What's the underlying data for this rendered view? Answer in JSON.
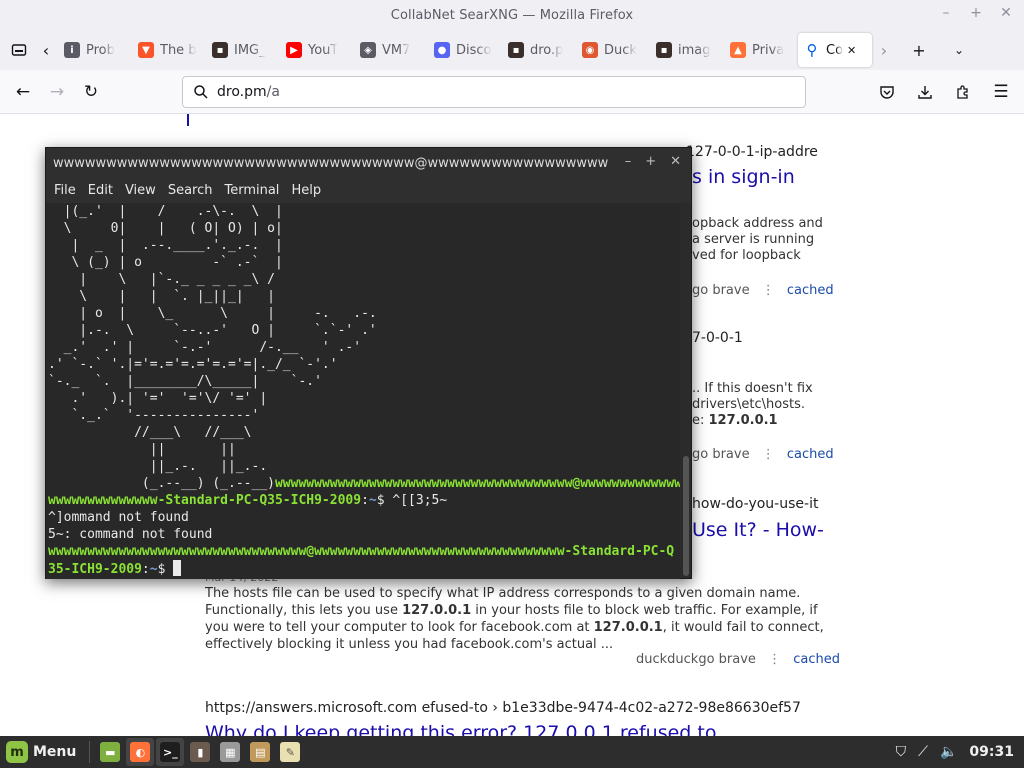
{
  "window": {
    "title": "CollabNet SearXNG — Mozilla Firefox",
    "controls": {
      "minimize": "–",
      "maximize": "+",
      "close": "✕"
    }
  },
  "tabs": [
    {
      "label": "Prob",
      "icon": "info-icon",
      "color": "#5b5b66",
      "glyph": "i"
    },
    {
      "label": "The b",
      "icon": "brave-icon",
      "color": "#fb542b",
      "glyph": "▼"
    },
    {
      "label": "IMG_",
      "icon": "image-file-icon",
      "color": "#3a2f2a",
      "glyph": "▪"
    },
    {
      "label": "YouT",
      "icon": "youtube-icon",
      "color": "#ff0000",
      "glyph": "▶"
    },
    {
      "label": "VM7",
      "icon": "vmware-icon",
      "color": "#5b5b66",
      "glyph": "◈"
    },
    {
      "label": "Disco",
      "icon": "discord-icon",
      "color": "#5865f2",
      "glyph": "●"
    },
    {
      "label": "dro.p",
      "icon": "image-file-icon",
      "color": "#3a2f2a",
      "glyph": "▪"
    },
    {
      "label": "Duck",
      "icon": "duckduckgo-icon",
      "color": "#de5833",
      "glyph": "◉"
    },
    {
      "label": "imag",
      "icon": "image-file-icon",
      "color": "#3a2f2a",
      "glyph": "▪"
    },
    {
      "label": "Priva",
      "icon": "privacy-icon",
      "color": "#ff7139",
      "glyph": "▲"
    },
    {
      "label": "Co",
      "icon": "search-icon",
      "color": "#0060df",
      "glyph": "⚲",
      "active": true
    }
  ],
  "url": {
    "host": "dro.pm",
    "path": "/a"
  },
  "results": [
    {
      "url_tail": "127-0-0-1-ip-addre",
      "title": "s in sign-in",
      "snippet": [
        "opback address and",
        "a server is running",
        "ved for loopback"
      ],
      "engines": "go  brave",
      "cached": "cached"
    },
    {
      "url_tail": "7-0-0-1",
      "snippet": [
        ".. If this doesn't fix",
        "drivers\\etc\\hosts.",
        "e: "
      ],
      "snippet_bold": "127.0.0.1",
      "engines": "go  brave",
      "cached": "cached"
    },
    {
      "url_tail": "how-do-you-use-it",
      "title": "Use It? - How-",
      "date": "Mar 14, 2022",
      "lines": [
        [
          "The hosts file can be used to specify what IP address corresponds to a given domain name."
        ],
        [
          "Functionally, this lets you use ",
          "127.0.0.1",
          " in your hosts file to block web traffic. For example, if"
        ],
        [
          "you were to tell your computer to look for facebook.com at ",
          "127.0.0.1",
          ", it would fail to connect,"
        ],
        [
          "effectively blocking it unless you had facebook.com's actual ..."
        ]
      ],
      "engines": "duckduckgo  brave",
      "cached": "cached"
    },
    {
      "url": "https://answers.microsoft.com  efused-to › b1e33dbe-9474-4c02-a272-98e86630ef57",
      "title": "Why do I keep getting this error? 127.0.0.1 refused to"
    }
  ],
  "terminal": {
    "title": "wwwwwwwwwwwwwwwwwwwwwwwwwwwwwwwwww@wwwwwwwwwwwwwwwww...",
    "controls": {
      "minimize": "–",
      "maximize": "+",
      "close": "✕"
    },
    "menu": [
      "File",
      "Edit",
      "View",
      "Search",
      "Terminal",
      "Help"
    ],
    "ascii_art": [
      "  |(_.'  |    /    .-\\-.  \\  |",
      "  \\     0|    |   ( O| O) | o|",
      "   |  _  |  .--.____.'._.-.  |",
      "   \\ (_) | o         -` .-`  |",
      "    |    \\   |`-._ _ _ _ _\\ /",
      "    \\    |   |  `. |_||_|   |",
      "    | o  |    \\_      \\     |     -.   .-.",
      "    |.-.  \\     `--..-'   O |     `.`-' .'",
      "  _.'  .' |     `-.-'      /-.__   ' .-'",
      ".' `-.` '.|='=.='=.='=.='=|._/_ `-'.'",
      "`-._  `.  |________/\\_____|    `-.'",
      "   .'   ).| '='  '='\\/ '=' |",
      "   `._.`  '---------------'",
      "           //___\\   //___\\",
      "             ||       ||",
      "             ||_.-.   ||_.-."
    ],
    "art_tail": "            (_.--__) (_.--__)",
    "prompt_user": "wwwwwwwwwwwwwwwwwwwwwwwwwwwwwwwwwwwwww@wwwwwwwwwwwwwwwwwwwwwwwwwwwwwwwwwwwwwwww-Standard-PC-Q35-ICH9-2009",
    "prompt_user_tail1": "wwwwwwwwwwwwwwwwwwwwwwwwwwwwwwwwwwwwww@wwwwwwwwwwwwwwwwww",
    "prompt_user_head1": "wwwwwwwwwwwwww-Standard-PC-Q35-ICH9-2009",
    "prompt_path": "~",
    "prompt_sign": "$ ",
    "typed_command": "^[[3;5~",
    "output": [
      "^]ommand not found",
      "5~: command not found"
    ],
    "prompt2_line1": "wwwwwwwwwwwwwwwwwwwwwwwwwwwwwwwww@wwwwwwwwwwwwwwwwwwwwwwwwwwwwwwww-Standard-PC-Q",
    "prompt2_line2": "35-ICH9-2009"
  },
  "taskbar": {
    "menu_label": "Menu",
    "clock": "09:31",
    "apps": [
      {
        "name": "file-manager-icon",
        "color": "#7fb03f",
        "glyph": "▬",
        "running": false
      },
      {
        "name": "firefox-icon",
        "color": "#ff7139",
        "glyph": "◐",
        "running": true
      },
      {
        "name": "terminal-icon",
        "color": "#1e1e1e",
        "glyph": ">_",
        "running": true
      },
      {
        "name": "app-icon-4",
        "color": "#6b5a4e",
        "glyph": "▮",
        "running": false
      },
      {
        "name": "app-icon-5",
        "color": "#9a9a9a",
        "glyph": "▦",
        "running": false
      },
      {
        "name": "archive-icon",
        "color": "#c19a5b",
        "glyph": "▤",
        "running": false
      },
      {
        "name": "text-editor-icon",
        "color": "#e8e0b0",
        "glyph": "✎",
        "running": false
      }
    ]
  }
}
